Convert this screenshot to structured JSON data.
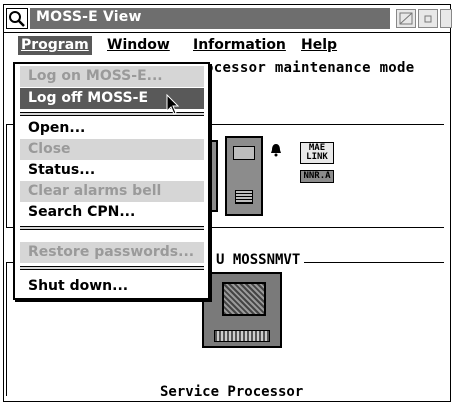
{
  "window": {
    "title": "MOSS-E View"
  },
  "menubar": {
    "program": "Program",
    "window": "Window",
    "information": "Information",
    "help": "Help"
  },
  "main": {
    "mode_text": "ocessor maintenance mode",
    "frame_label": "U MOSSNMVT",
    "service_label": "Service Processor",
    "badges": [
      "MAE LINK",
      "NNR.A"
    ]
  },
  "program_menu": {
    "items": [
      {
        "label": "Log on MOSS-E...",
        "state": "disabled"
      },
      {
        "label": "Log off MOSS-E",
        "state": "highlighted"
      },
      {
        "label": "Open...",
        "state": "enabled"
      },
      {
        "label": "Close",
        "state": "disabled"
      },
      {
        "label": "Status...",
        "state": "enabled"
      },
      {
        "label": "Clear alarms bell",
        "state": "disabled"
      },
      {
        "label": "Search CPN...",
        "state": "enabled"
      },
      {
        "label": "Restore passwords...",
        "state": "disabled"
      },
      {
        "label": "Shut down...",
        "state": "enabled"
      }
    ]
  },
  "icons": {
    "system_menu": "search-icon",
    "bell": "bell-icon",
    "computer": "computer-icon"
  }
}
